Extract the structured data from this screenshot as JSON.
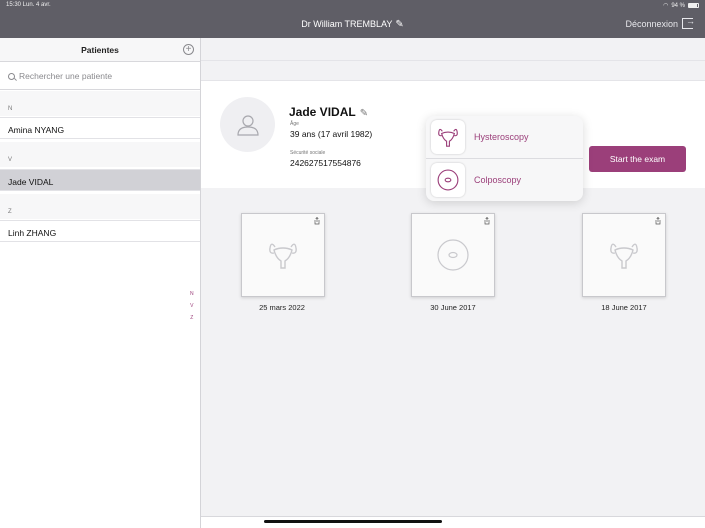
{
  "status": {
    "time": "15:30  Lun. 4 avr.",
    "battery": "94 %"
  },
  "header": {
    "doctor": "Dr William TREMBLAY",
    "logout": "Déconnexion"
  },
  "sidebar": {
    "title": "Patientes",
    "search_placeholder": "Rechercher une patiente",
    "sections": [
      {
        "letter": "N",
        "patients": [
          "Amina NYANG"
        ]
      },
      {
        "letter": "V",
        "patients": [
          "Jade VIDAL"
        ]
      },
      {
        "letter": "Z",
        "patients": [
          "Linh ZHANG"
        ]
      }
    ],
    "selected": "Jade VIDAL",
    "index": [
      "N",
      "V",
      "Z"
    ]
  },
  "patient": {
    "name": "Jade VIDAL",
    "age_label": "Âge",
    "age_value": "39 ans (17 avril 1982)",
    "ssn_label": "Sécurité sociale",
    "ssn_value": "242627517554876"
  },
  "start_button": "Start the exam",
  "popover": {
    "items": [
      {
        "label": "Hysteroscopy",
        "icon": "uterus-icon"
      },
      {
        "label": "Colposcopy",
        "icon": "cervix-icon"
      }
    ]
  },
  "exams": [
    {
      "date": "25 mars 2022",
      "icon": "uterus-icon"
    },
    {
      "date": "30 June 2017",
      "icon": "cervix-icon"
    },
    {
      "date": "18 June 2017",
      "icon": "uterus-icon"
    }
  ],
  "colors": {
    "accent": "#9b3f7a",
    "topbar": "#5f5e66"
  }
}
